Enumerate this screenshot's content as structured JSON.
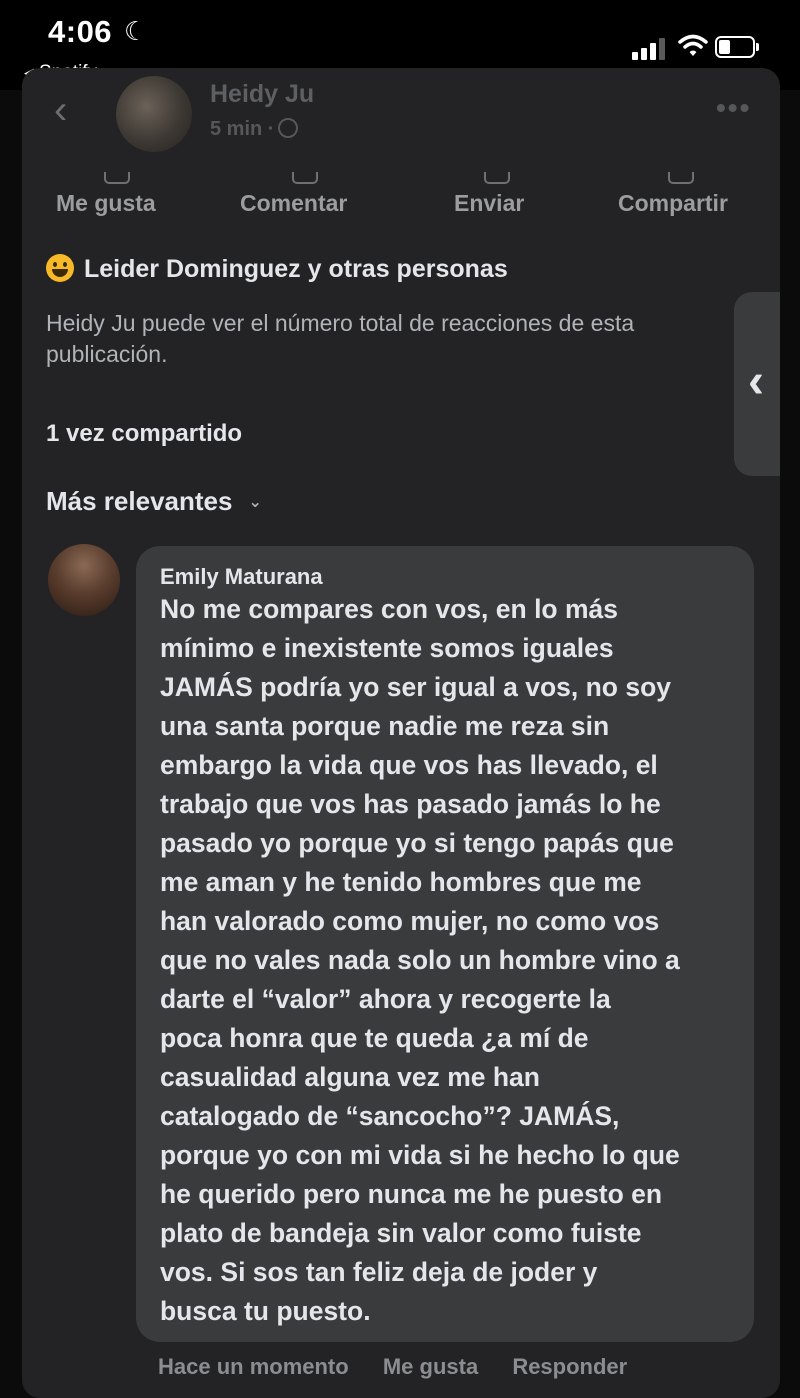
{
  "status_bar": {
    "time": "4:06",
    "back_app": "Spotify",
    "moon_icon": "moon-icon",
    "signal_icon": "cellular-signal-icon",
    "wifi_icon": "wifi-icon",
    "battery_icon": "battery-icon"
  },
  "post": {
    "author": "Heidy Ju",
    "time": "5 min ·",
    "actions": {
      "like": "Me gusta",
      "comment": "Comentar",
      "send": "Enviar",
      "share": "Compartir"
    },
    "reactions": "Leider Dominguez y otras personas",
    "privacy_note": "Heidy Ju puede ver el número total de reacciones de esta publicación.",
    "shares": "1 vez compartido",
    "sort_label": "Más relevantes"
  },
  "comment": {
    "author": "Emily Maturana",
    "text": "No me compares con vos, en lo más\nmínimo e inexistente somos iguales\nJAMÁS podría yo ser igual a vos, no soy\nuna santa porque nadie me reza sin\nembargo la vida que vos has llevado, el\ntrabajo que vos has pasado jamás lo he\npasado yo porque yo si tengo papás que\nme aman y he tenido hombres que me\nhan valorado como mujer, no como vos\nque no vales nada solo un hombre vino a\ndarte el “valor” ahora y recogerte la\npoca honra que te queda ¿a mí de\ncasualidad alguna vez me han\ncatalogado de “sancocho”? JAMÁS,\nporque yo con mi vida si he hecho lo que\nhe querido pero nunca me he puesto en\nplato de bandeja sin valor como fuiste\nvos. Si sos tan feliz deja de joder y\nbusca tu puesto.",
    "footer": {
      "time": "Hace un momento",
      "like": "Me gusta",
      "reply": "Responder"
    }
  },
  "colors": {
    "background": "#0b0b0c",
    "panel": "#232325",
    "bubble": "#3a3b3d",
    "text_primary": "#e4e6eb",
    "text_secondary": "#b0b3b8"
  }
}
